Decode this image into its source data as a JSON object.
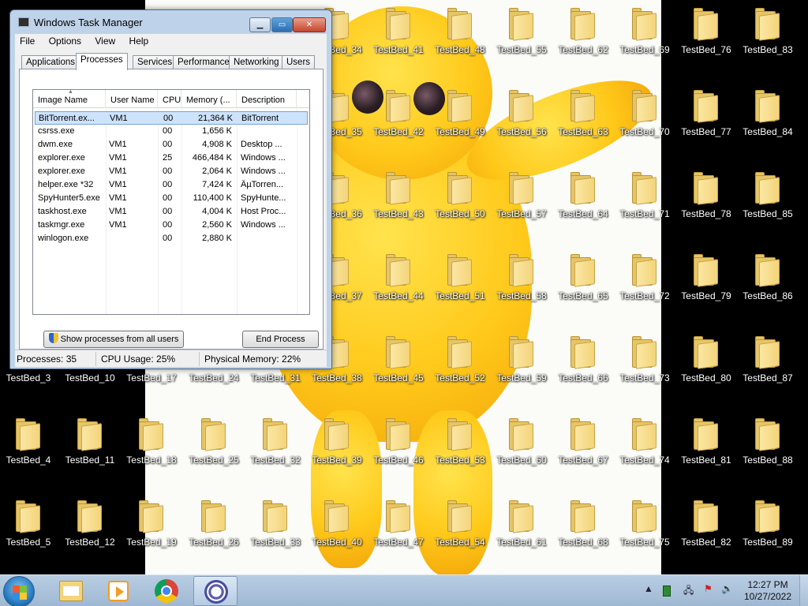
{
  "desktop": {
    "icons": [
      {
        "label": "TestBed_34"
      },
      {
        "label": "TestBed_41"
      },
      {
        "label": "TestBed_48"
      },
      {
        "label": "TestBed_55"
      },
      {
        "label": "TestBed_62"
      },
      {
        "label": "TestBed_69"
      },
      {
        "label": "TestBed_76"
      },
      {
        "label": "TestBed_83"
      },
      {
        "label": "TestBed_35"
      },
      {
        "label": "TestBed_42"
      },
      {
        "label": "TestBed_49"
      },
      {
        "label": "TestBed_56"
      },
      {
        "label": "TestBed_63"
      },
      {
        "label": "TestBed_70"
      },
      {
        "label": "TestBed_77"
      },
      {
        "label": "TestBed_84"
      },
      {
        "label": "TestBed_36"
      },
      {
        "label": "TestBed_43"
      },
      {
        "label": "TestBed_50"
      },
      {
        "label": "TestBed_57"
      },
      {
        "label": "TestBed_64"
      },
      {
        "label": "TestBed_71"
      },
      {
        "label": "TestBed_78"
      },
      {
        "label": "TestBed_85"
      },
      {
        "label": "TestBed_37"
      },
      {
        "label": "TestBed_44"
      },
      {
        "label": "TestBed_51"
      },
      {
        "label": "TestBed_58"
      },
      {
        "label": "TestBed_65"
      },
      {
        "label": "TestBed_72"
      },
      {
        "label": "TestBed_79"
      },
      {
        "label": "TestBed_86"
      },
      {
        "label": "TestBed_3"
      },
      {
        "label": "TestBed_10"
      },
      {
        "label": "TestBed_17"
      },
      {
        "label": "TestBed_24"
      },
      {
        "label": "TestBed_31"
      },
      {
        "label": "TestBed_38"
      },
      {
        "label": "TestBed_45"
      },
      {
        "label": "TestBed_52"
      },
      {
        "label": "TestBed_59"
      },
      {
        "label": "TestBed_66"
      },
      {
        "label": "TestBed_73"
      },
      {
        "label": "TestBed_80"
      },
      {
        "label": "TestBed_87"
      },
      {
        "label": "TestBed_4"
      },
      {
        "label": "TestBed_11"
      },
      {
        "label": "TestBed_18"
      },
      {
        "label": "TestBed_25"
      },
      {
        "label": "TestBed_32"
      },
      {
        "label": "TestBed_39"
      },
      {
        "label": "TestBed_46"
      },
      {
        "label": "TestBed_53"
      },
      {
        "label": "TestBed_60"
      },
      {
        "label": "TestBed_67"
      },
      {
        "label": "TestBed_74"
      },
      {
        "label": "TestBed_81"
      },
      {
        "label": "TestBed_88"
      },
      {
        "label": "TestBed_5"
      },
      {
        "label": "TestBed_12"
      },
      {
        "label": "TestBed_19"
      },
      {
        "label": "TestBed_26"
      },
      {
        "label": "TestBed_33"
      },
      {
        "label": "TestBed_40"
      },
      {
        "label": "TestBed_47"
      },
      {
        "label": "TestBed_54"
      },
      {
        "label": "TestBed_61"
      },
      {
        "label": "TestBed_68"
      },
      {
        "label": "TestBed_75"
      },
      {
        "label": "TestBed_82"
      },
      {
        "label": "TestBed_89"
      }
    ]
  },
  "task_manager": {
    "title": "Windows Task Manager",
    "menu": [
      "File",
      "Options",
      "View",
      "Help"
    ],
    "tabs": [
      "Applications",
      "Processes",
      "Services",
      "Performance",
      "Networking",
      "Users"
    ],
    "active_tab": "Processes",
    "columns": [
      "Image Name",
      "User Name",
      "CPU",
      "Memory (...",
      "Description"
    ],
    "processes": [
      {
        "name": "BitTorrent.ex...",
        "user": "VM1",
        "cpu": "00",
        "memory": "21,364 K",
        "description": "BitTorrent",
        "selected": true
      },
      {
        "name": "csrss.exe",
        "user": "",
        "cpu": "00",
        "memory": "1,656 K",
        "description": ""
      },
      {
        "name": "dwm.exe",
        "user": "VM1",
        "cpu": "00",
        "memory": "4,908 K",
        "description": "Desktop ..."
      },
      {
        "name": "explorer.exe",
        "user": "VM1",
        "cpu": "25",
        "memory": "466,484 K",
        "description": "Windows ..."
      },
      {
        "name": "explorer.exe",
        "user": "VM1",
        "cpu": "00",
        "memory": "2,064 K",
        "description": "Windows ..."
      },
      {
        "name": "helper.exe *32",
        "user": "VM1",
        "cpu": "00",
        "memory": "7,424 K",
        "description": "ÂµTorren..."
      },
      {
        "name": "SpyHunter5.exe",
        "user": "VM1",
        "cpu": "00",
        "memory": "110,400 K",
        "description": "SpyHunte..."
      },
      {
        "name": "taskhost.exe",
        "user": "VM1",
        "cpu": "00",
        "memory": "4,004 K",
        "description": "Host Proc..."
      },
      {
        "name": "taskmgr.exe",
        "user": "VM1",
        "cpu": "00",
        "memory": "2,560 K",
        "description": "Windows ..."
      },
      {
        "name": "winlogon.exe",
        "user": "",
        "cpu": "00",
        "memory": "2,880 K",
        "description": ""
      }
    ],
    "show_all_label": "Show processes from all users",
    "end_process_label": "End Process",
    "status": {
      "processes": "Processes: 35",
      "cpu": "CPU Usage: 25%",
      "memory": "Physical Memory: 22%"
    }
  },
  "taskbar": {
    "pinned": [
      {
        "icon": "windows-explorer-icon"
      },
      {
        "icon": "media-player-icon"
      },
      {
        "icon": "chrome-icon"
      },
      {
        "icon": "bittorrent-icon",
        "active": true
      }
    ],
    "clock": {
      "time": "12:27 PM",
      "date": "10/27/2022"
    }
  },
  "colors": {
    "selection": "#cde3fb",
    "taskbar": "#b8cde3",
    "title_bar": "#bed3ea"
  }
}
